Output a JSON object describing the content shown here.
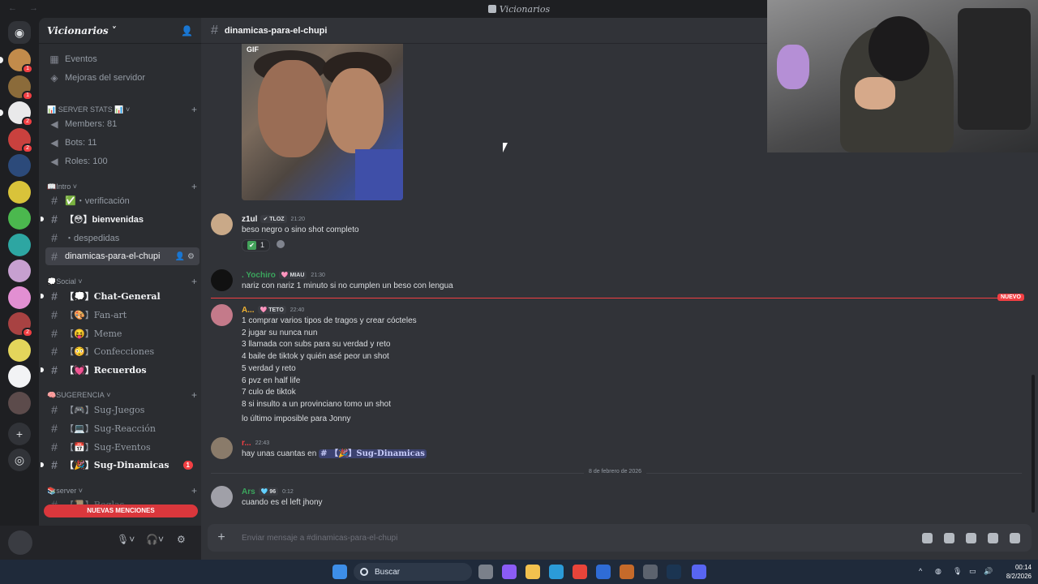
{
  "window": {
    "title": "Vicionarios",
    "nav": "← →"
  },
  "server": {
    "name": "Vicionarios"
  },
  "rail": {
    "servers": [
      {
        "color": "#c28b4b",
        "badge": "1",
        "pill": true
      },
      {
        "color": "#8b6b3a",
        "badge": "1",
        "pill": false
      },
      {
        "color": "#e9e9ea",
        "badge": "2",
        "pill": true
      },
      {
        "color": "#c9413e",
        "badge": "2",
        "pill": false
      },
      {
        "color": "#2c4a7a",
        "badge": "",
        "pill": false
      },
      {
        "color": "#d9c33a",
        "badge": "",
        "pill": false
      },
      {
        "color": "#4bb84e",
        "badge": "",
        "pill": false
      },
      {
        "color": "#2da6a2",
        "badge": "",
        "pill": false
      },
      {
        "color": "#c7a0d0",
        "badge": "",
        "pill": false
      },
      {
        "color": "#e28fd2",
        "badge": "",
        "pill": false
      },
      {
        "color": "#a84242",
        "badge": "2",
        "pill": false
      },
      {
        "color": "#e4d55b",
        "badge": "",
        "pill": false
      },
      {
        "color": "#f2f3f5",
        "badge": "",
        "pill": false
      },
      {
        "color": "#5c4b4b",
        "badge": "",
        "pill": false
      }
    ]
  },
  "sidebar": {
    "top_items": [
      {
        "icon": "calendar-icon",
        "label": "Eventos"
      },
      {
        "icon": "boost-icon",
        "label": "Mejoras del servidor"
      }
    ],
    "categories": {
      "stats": "📊 SERVER STATS 📊",
      "intro": "📖Intro",
      "social": "💭Social",
      "sugerencia": "🧠SUGERENCIA",
      "server": "📚server"
    },
    "stats": [
      "Members: 81",
      "Bots: 11",
      "Roles: 100"
    ],
    "intro_channels": [
      {
        "label": "✅・verificación",
        "bold": false
      },
      {
        "label": "【😳】bienvenidas",
        "bold": true
      },
      {
        "label": "・despedidas",
        "bold": false
      },
      {
        "label": "dinamicas-para-el-chupi",
        "bold": true,
        "active": true
      }
    ],
    "social_channels": [
      {
        "label": "【💭】Chat-General",
        "bold": true
      },
      {
        "label": "【🎨】Fan-art",
        "bold": false
      },
      {
        "label": "【😝】Meme",
        "bold": false
      },
      {
        "label": "【😳】Confecciones",
        "bold": false
      },
      {
        "label": "【💓】Recuerdos",
        "bold": true
      }
    ],
    "sugerencia_channels": [
      {
        "label": "【🎮】Sug-Juegos",
        "bold": false
      },
      {
        "label": "【💻】Sug-Reacción",
        "bold": false
      },
      {
        "label": "【📅】Sug-Eventos",
        "bold": false
      },
      {
        "label": "【🎉】Sug-Dinamicas",
        "bold": true,
        "badge": "1"
      }
    ],
    "server_partial": "【📜】Reglas",
    "new_mentions": "NUEVAS MENCIONES"
  },
  "channel": {
    "name": "dinamicas-para-el-chupi"
  },
  "gif_label": "GIF",
  "messages": [
    {
      "author": "z1ul",
      "author_color": "#f2f3f5",
      "tag": "✔ TLOZ",
      "time": "21:20",
      "lines": [
        "beso negro o sino shot completo"
      ],
      "reaction": {
        "emoji": "✔",
        "count": "1"
      },
      "avatar": "#c9a988"
    },
    {
      "author": ". Yochiro",
      "author_color": "#3ba55d",
      "tag": "🩷 MIAU",
      "time": "21:30",
      "lines": [
        "nariz con nariz 1 minuto si no cumplen un beso con lengua"
      ],
      "avatar": "#1a1a1a"
    },
    {
      "author": "A...",
      "author_color": "#f0b232",
      "tag": "🩷 TETO",
      "time": "22:40",
      "lines": [
        "1 comprar varios tipos de tragos y crear cócteles",
        "2 jugar su nunca nun",
        "3 llamada con subs para su verdad y reto",
        "4 baile de tiktok y quién asé peor un shot",
        "5 verdad y reto",
        "6 pvz en half life",
        "7 culo de tiktok",
        "8 si insulto a un provinciano tomo un shot"
      ],
      "extra": "lo último imposible para Jonny",
      "avatar": "#c47a8a"
    },
    {
      "author": "r...",
      "author_color": "#f23f43",
      "tag": "",
      "time": "22:43",
      "text_before": "hay unas cuantas en",
      "mention": "# 【🎉】Sug-Dinamicas",
      "avatar": "#8a7b6a"
    },
    {
      "author": "Ars",
      "author_color": "#3ba55d",
      "tag": "🩵 96",
      "time": "0:12",
      "lines": [
        "cuando es el left jhony"
      ],
      "avatar": "#a0a0a8"
    }
  ],
  "new_label": "NUEVO",
  "date_separator": "8 de febrero de 2026",
  "composer": {
    "placeholder": "Enviar mensaje a #dinamicas-para-el-chupi"
  },
  "taskbar": {
    "search": "Buscar",
    "time": "00:14",
    "date": "8/2/2026"
  }
}
